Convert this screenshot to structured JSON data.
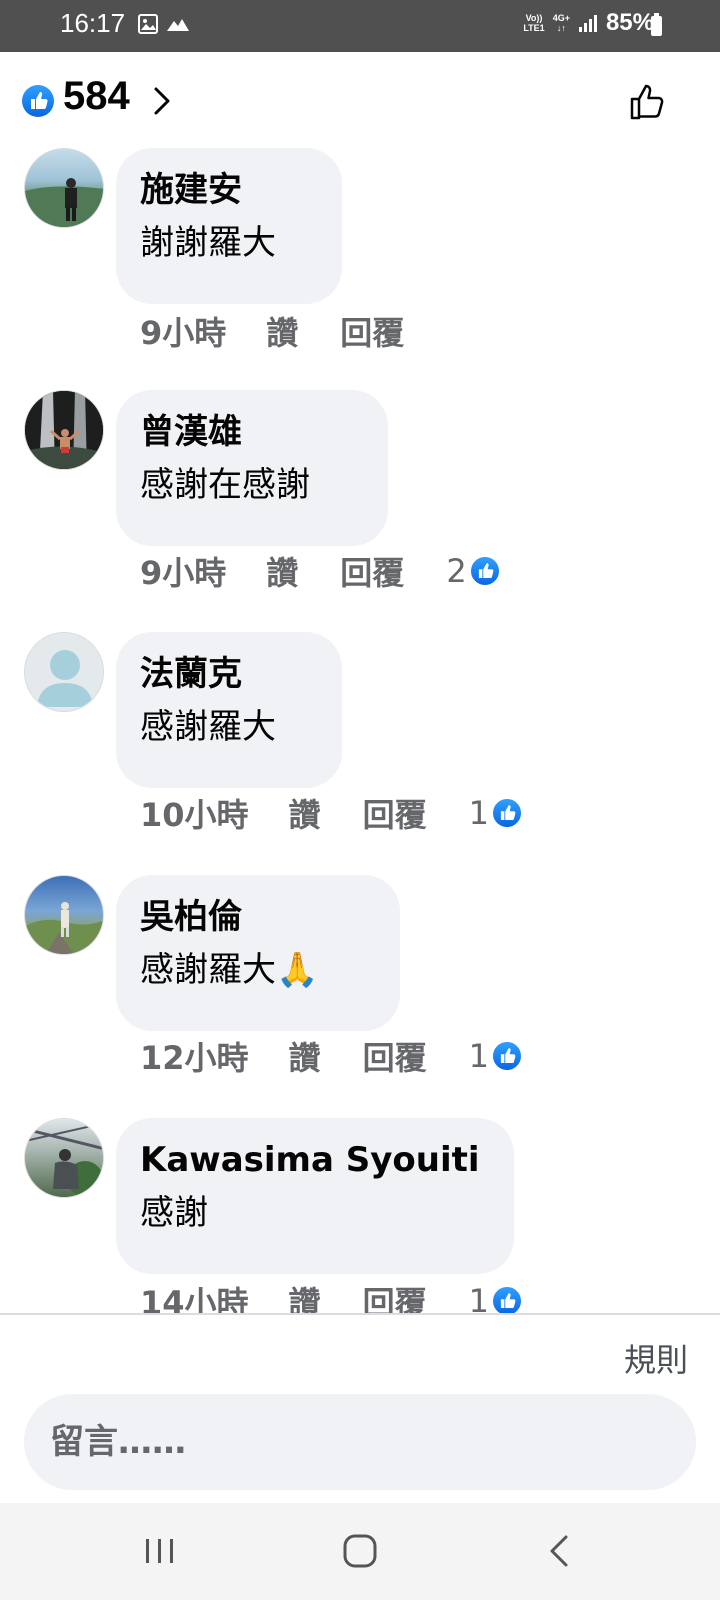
{
  "status_bar": {
    "time": "16:17",
    "network_top": "Vo))",
    "network_bottom": "LTE1",
    "data_type": "4G+",
    "battery": "85%"
  },
  "reactions": {
    "count": "584"
  },
  "comments": [
    {
      "author": "施建安",
      "text": "謝謝羅大",
      "time": "9小時",
      "like_label": "讚",
      "reply_label": "回覆",
      "reaction_count": ""
    },
    {
      "author": "曾漢雄",
      "text": "感謝在感謝",
      "time": "9小時",
      "like_label": "讚",
      "reply_label": "回覆",
      "reaction_count": "2"
    },
    {
      "author": "法蘭克",
      "text": "感謝羅大",
      "time": "10小時",
      "like_label": "讚",
      "reply_label": "回覆",
      "reaction_count": "1"
    },
    {
      "author": "吳柏倫",
      "text": "感謝羅大🙏",
      "time": "12小時",
      "like_label": "讚",
      "reply_label": "回覆",
      "reaction_count": "1"
    },
    {
      "author": "Kawasima Syouiti",
      "text": "感謝",
      "time": "14小時",
      "like_label": "讚",
      "reply_label": "回覆",
      "reaction_count": "1"
    }
  ],
  "footer": {
    "rules_label": "規則",
    "input_placeholder": "留言……"
  },
  "colors": {
    "like_blue": "#1877f2",
    "bubble_bg": "#f0f2f5",
    "meta_gray": "#65676b"
  }
}
